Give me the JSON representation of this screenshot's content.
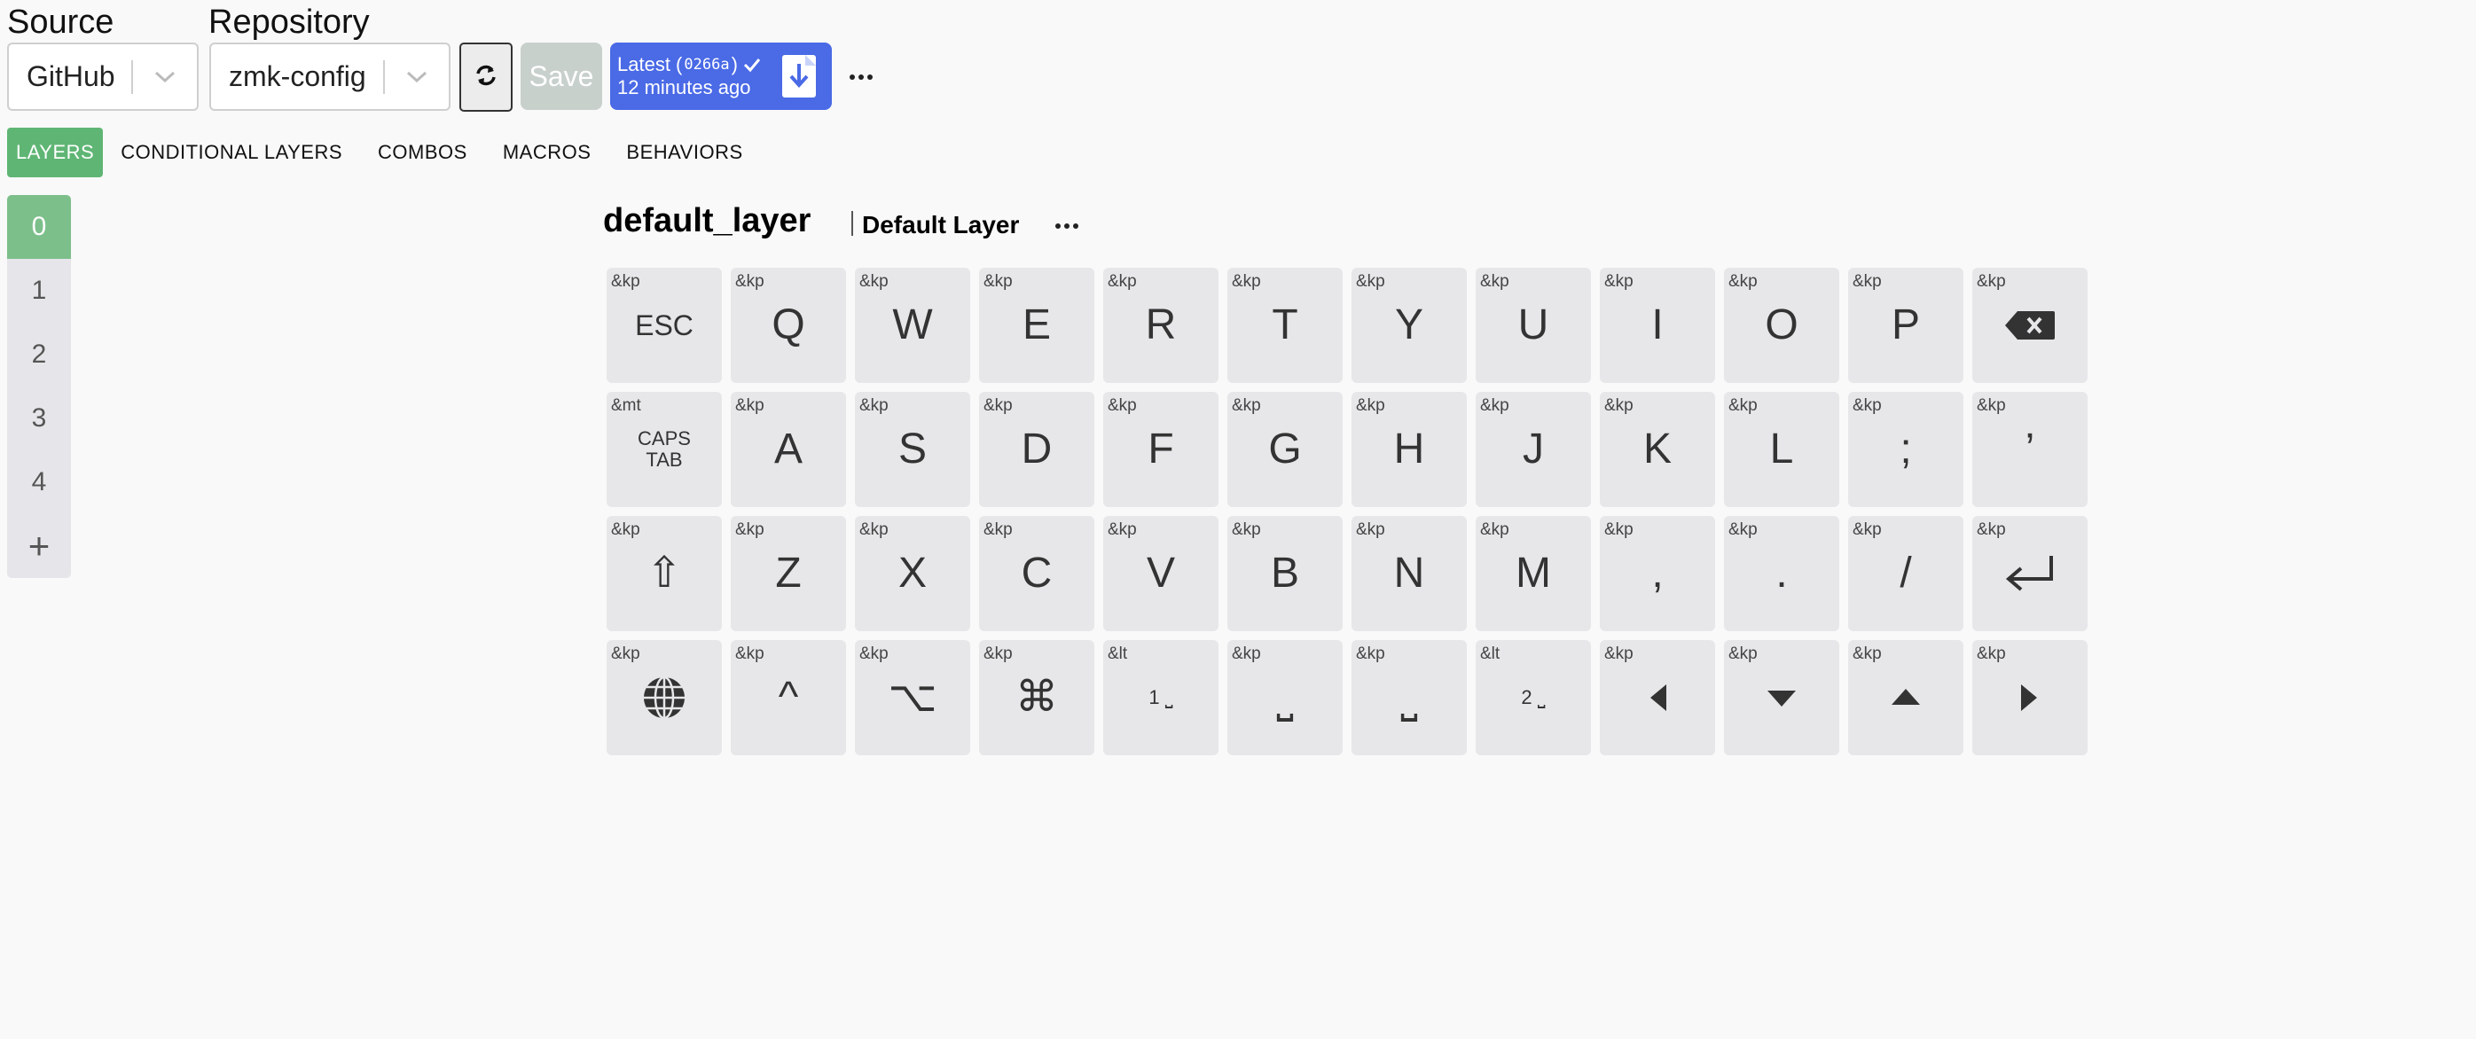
{
  "header": {
    "source_label": "Source",
    "source_value": "GitHub",
    "repo_label": "Repository",
    "repo_value": "zmk-config",
    "save_label": "Save",
    "latest_prefix": "Latest (",
    "latest_code": "0266a",
    "latest_suffix": ")",
    "latest_time": "12 minutes ago"
  },
  "tabs": [
    "LAYERS",
    "CONDITIONAL LAYERS",
    "COMBOS",
    "MACROS",
    "BEHAVIORS"
  ],
  "layers": [
    "0",
    "1",
    "2",
    "3",
    "4"
  ],
  "add_layer": "+",
  "layer": {
    "id": "default_layer",
    "name": "Default Layer"
  },
  "keys": [
    {
      "b": "&kp",
      "l": "ESC",
      "s": "small"
    },
    {
      "b": "&kp",
      "l": "Q"
    },
    {
      "b": "&kp",
      "l": "W"
    },
    {
      "b": "&kp",
      "l": "E"
    },
    {
      "b": "&kp",
      "l": "R"
    },
    {
      "b": "&kp",
      "l": "T"
    },
    {
      "b": "&kp",
      "l": "Y"
    },
    {
      "b": "&kp",
      "l": "U"
    },
    {
      "b": "&kp",
      "l": "I"
    },
    {
      "b": "&kp",
      "l": "O"
    },
    {
      "b": "&kp",
      "l": "P"
    },
    {
      "b": "&kp",
      "icon": "backspace-icon"
    },
    {
      "b": "&mt",
      "l": "CAPS\nTAB",
      "s": "tiny"
    },
    {
      "b": "&kp",
      "l": "A"
    },
    {
      "b": "&kp",
      "l": "S"
    },
    {
      "b": "&kp",
      "l": "D"
    },
    {
      "b": "&kp",
      "l": "F"
    },
    {
      "b": "&kp",
      "l": "G"
    },
    {
      "b": "&kp",
      "l": "H"
    },
    {
      "b": "&kp",
      "l": "J"
    },
    {
      "b": "&kp",
      "l": "K"
    },
    {
      "b": "&kp",
      "l": "L"
    },
    {
      "b": "&kp",
      "l": ";"
    },
    {
      "b": "&kp",
      "l": "’"
    },
    {
      "b": "&kp",
      "l": "⇧"
    },
    {
      "b": "&kp",
      "l": "Z"
    },
    {
      "b": "&kp",
      "l": "X"
    },
    {
      "b": "&kp",
      "l": "C"
    },
    {
      "b": "&kp",
      "l": "V"
    },
    {
      "b": "&kp",
      "l": "B"
    },
    {
      "b": "&kp",
      "l": "N"
    },
    {
      "b": "&kp",
      "l": "M"
    },
    {
      "b": "&kp",
      "l": ","
    },
    {
      "b": "&kp",
      "l": "."
    },
    {
      "b": "&kp",
      "l": "/"
    },
    {
      "b": "&kp",
      "icon": "enter-icon"
    },
    {
      "b": "&kp",
      "icon": "globe-icon"
    },
    {
      "b": "&kp",
      "l": "^"
    },
    {
      "b": "&kp",
      "l": "⌥"
    },
    {
      "b": "&kp",
      "l": "⌘"
    },
    {
      "b": "&lt",
      "l": "1 ⎵",
      "s": "sp"
    },
    {
      "b": "&kp",
      "l": "⎵"
    },
    {
      "b": "&kp",
      "l": "⎵"
    },
    {
      "b": "&lt",
      "l": "2 ⎵",
      "s": "sp"
    },
    {
      "b": "&kp",
      "icon": "arrow-left-icon"
    },
    {
      "b": "&kp",
      "icon": "arrow-down-icon"
    },
    {
      "b": "&kp",
      "icon": "arrow-up-icon"
    },
    {
      "b": "&kp",
      "icon": "arrow-right-icon"
    }
  ],
  "colors": {
    "accent_green": "#5fb574",
    "accent_blue": "#4a6ae6",
    "key_bg": "#e7e7ea"
  }
}
